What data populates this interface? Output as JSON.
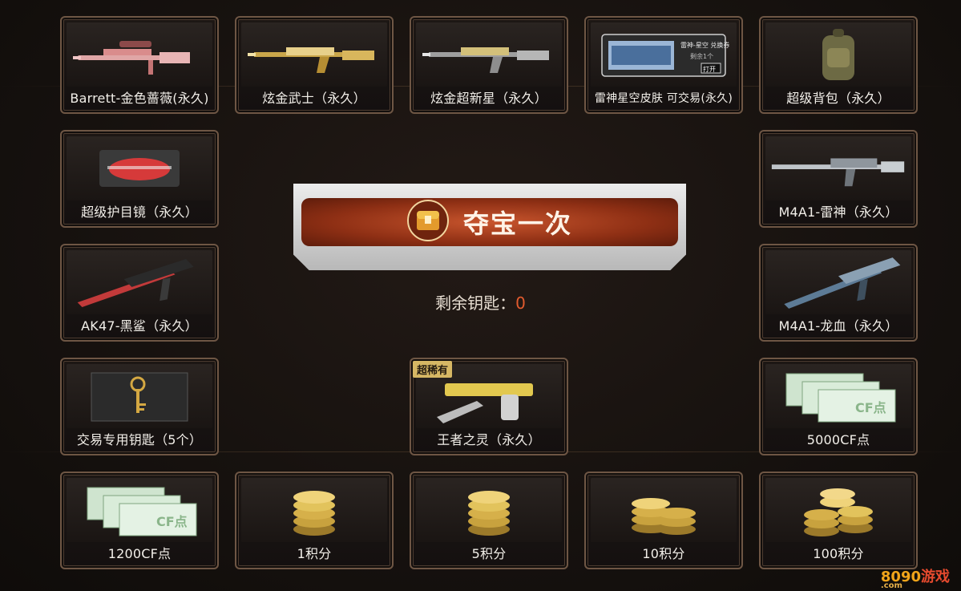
{
  "items": [
    {
      "label": "Barrett-金色蔷薇(永久)",
      "icon": "sniper-rifle-icon"
    },
    {
      "label": "炫金武士（永久）",
      "icon": "rifle-icon"
    },
    {
      "label": "炫金超新星（永久）",
      "icon": "rifle-icon"
    },
    {
      "label": "雷神星空皮肤 可交易(永久)",
      "icon": "ticket-icon"
    },
    {
      "label": "超级背包（永久）",
      "icon": "backpack-icon"
    },
    {
      "label": "超级护目镜（永久）",
      "icon": "goggles-icon"
    },
    {
      "label": "M4A1-雷神（永久）",
      "icon": "rifle-icon"
    },
    {
      "label": "AK47-黑鲨（永久）",
      "icon": "rifle-icon"
    },
    {
      "label": "M4A1-龙血（永久）",
      "icon": "rifle-icon"
    },
    {
      "label": "交易专用钥匙（5个）",
      "icon": "key-icon"
    },
    {
      "label": "王者之灵（永久）",
      "icon": "pistol-icon",
      "badge": "超稀有"
    },
    {
      "label": "5000CF点",
      "icon": "cf-voucher-icon"
    },
    {
      "label": "1200CF点",
      "icon": "cf-voucher-icon"
    },
    {
      "label": "1积分",
      "icon": "coins-icon"
    },
    {
      "label": "5积分",
      "icon": "coins-icon"
    },
    {
      "label": "10积分",
      "icon": "coins-icon"
    },
    {
      "label": "100积分",
      "icon": "coins-icon"
    }
  ],
  "ticket_text": {
    "line1": "雷神-星空 兑换券",
    "line2": "剩余1个",
    "button": "打开"
  },
  "voucher_text": "CF点",
  "cta": {
    "label": "夺宝一次",
    "icon": "treasure-chest-icon"
  },
  "keys": {
    "label": "剩余钥匙：",
    "value": "0"
  },
  "watermark": {
    "text": "8090",
    "suffix": "游戏",
    "sub": ".com"
  },
  "colors": {
    "accent": "#e25b2e",
    "frame": "#6e5644",
    "button_red": "#a8391a"
  }
}
